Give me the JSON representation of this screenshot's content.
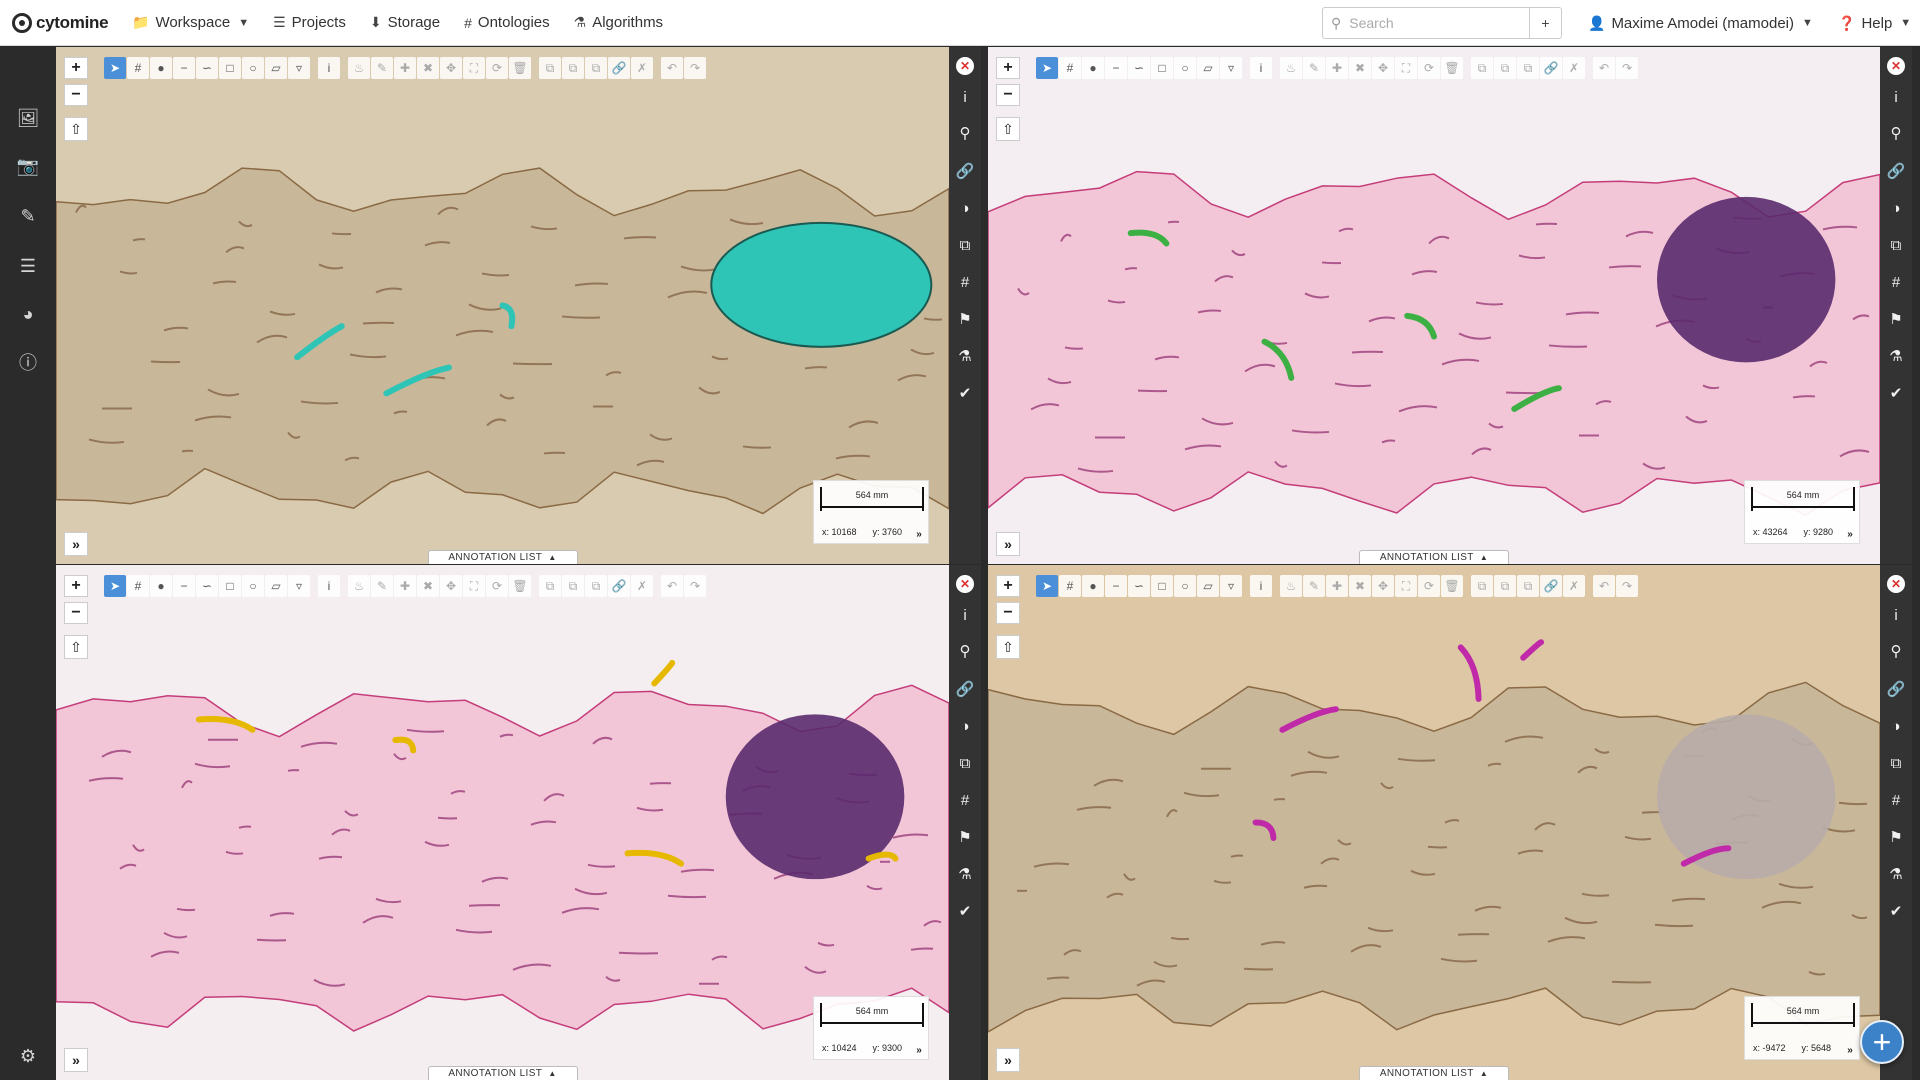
{
  "brand": {
    "name": "cytomine"
  },
  "nav": {
    "items": [
      {
        "label": "Workspace",
        "icon": "folder-icon",
        "has_caret": true
      },
      {
        "label": "Projects",
        "icon": "list-icon"
      },
      {
        "label": "Storage",
        "icon": "download-icon"
      },
      {
        "label": "Ontologies",
        "icon": "hashtag-icon"
      },
      {
        "label": "Algorithms",
        "icon": "flask-icon"
      }
    ],
    "search_placeholder": "Search",
    "search_add": "+",
    "user": "Maxime Amodei (mamodei)",
    "help": "Help"
  },
  "sidebar": {
    "icons": [
      "image-icon",
      "images-icon",
      "edit-icon",
      "tasks-icon",
      "dashboard-icon",
      "info-icon"
    ],
    "bottom_icon": "settings-icon"
  },
  "viewers": [
    {
      "stain": "DAB-brown",
      "background": "#d9cbb0",
      "annotation_color": "#2ec4b6",
      "scale_label": "564 mm",
      "x_label": "x: 10168",
      "y_label": "y: 3760",
      "annotation_list": "ANNOTATION LIST"
    },
    {
      "stain": "H&E-pink",
      "background": "#f4eef2",
      "annotation_color": "#3cb043",
      "scale_label": "564 mm",
      "x_label": "x: 43264",
      "y_label": "y: 9280",
      "annotation_list": "ANNOTATION LIST"
    },
    {
      "stain": "H&E-pink",
      "background": "#f4eef1",
      "annotation_color": "#e6b800",
      "scale_label": "564 mm",
      "x_label": "x: 10424",
      "y_label": "y: 9300",
      "annotation_list": "ANNOTATION LIST"
    },
    {
      "stain": "DAB-brown",
      "background": "#ddc7a4",
      "annotation_color": "#c02aa8",
      "scale_label": "564 mm",
      "x_label": "x: -9472",
      "y_label": "y: 5648",
      "annotation_list": "ANNOTATION LIST"
    }
  ],
  "viewer_tools": [
    "select-icon",
    "hashtag-icon",
    "point-icon",
    "line-icon",
    "freehand-line-icon",
    "rectangle-icon",
    "circle-icon",
    "polygon-icon",
    "freehand-polygon-icon",
    "info-icon",
    "fill-icon",
    "edit-icon",
    "add-correction-icon",
    "remove-correction-icon",
    "move-icon",
    "resize-icon",
    "rotate-icon",
    "delete-icon",
    "copy-icon",
    "paste-icon",
    "repeat-icon",
    "link-icon",
    "unlink-icon",
    "undo-icon",
    "redo-icon"
  ],
  "side_tools": [
    "close-icon",
    "info-icon",
    "search-icon",
    "link-icon",
    "contrast-icon",
    "copy-icon",
    "hashtag-icon",
    "tag-icon",
    "microscope-icon",
    "check-circle-icon"
  ],
  "fab": "+"
}
